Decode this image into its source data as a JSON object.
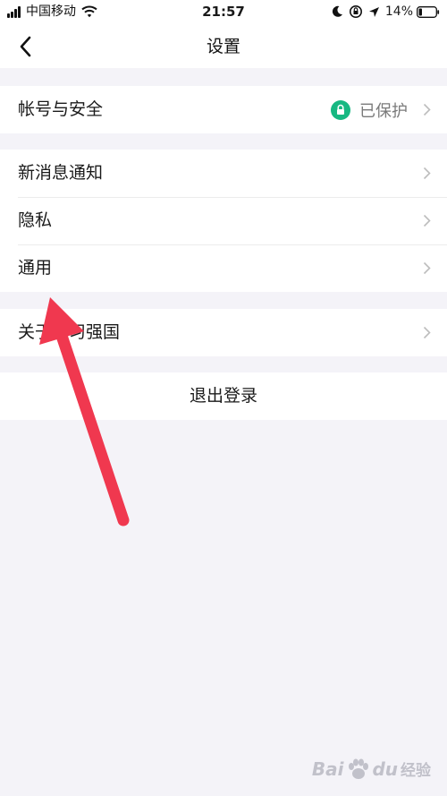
{
  "status_bar": {
    "carrier": "中国移动",
    "time": "21:57",
    "battery_percent": "14%"
  },
  "nav": {
    "title": "设置"
  },
  "groups": {
    "account": {
      "label": "帐号与安全",
      "status": "已保护"
    },
    "general": {
      "items": [
        {
          "label": "新消息通知"
        },
        {
          "label": "隐私"
        },
        {
          "label": "通用"
        }
      ]
    },
    "about": {
      "label": "关于学习强国"
    }
  },
  "logout": {
    "label": "退出登录"
  },
  "colors": {
    "accent_green": "#17b882",
    "annotation_red": "#f0384f",
    "background": "#f4f3f8"
  },
  "icons": [
    "signal-icon",
    "wifi-icon",
    "moon-icon",
    "orientation-lock-icon",
    "location-icon",
    "battery-icon",
    "back-chevron-icon",
    "lock-icon",
    "chevron-right-icon"
  ],
  "watermark": {
    "text_latin_1": "Bai",
    "text_latin_2": "du",
    "text_cn": "经验"
  }
}
